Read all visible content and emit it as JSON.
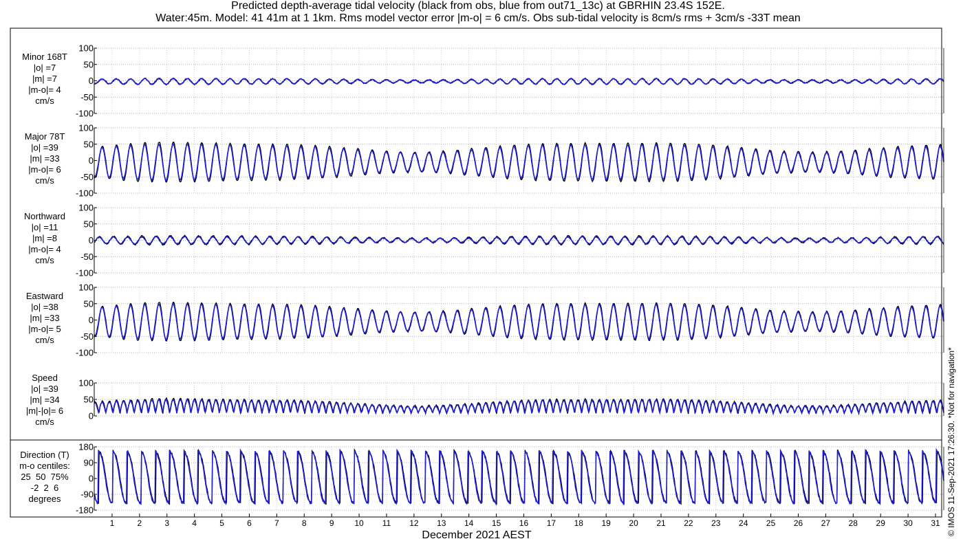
{
  "title_line1": "Predicted depth-average tidal velocity (black from obs, blue from out71_13c) at GBRHIN 23.4S 152E.",
  "title_line2": "Water:45m. Model: 41 41m at 1 1km. Rms model vector error |m-o| = 6 cm/s. Obs sub-tidal velocity is 8cm/s rms + 3cm/s -33T mean",
  "footer_note": "© IMOS 11-Sep-2021 17:26:30. *Not for navigation*",
  "colors": {
    "obs": "#000000",
    "model": "#1f1fd6",
    "grid": "#999999"
  },
  "chart_data": {
    "type": "line",
    "xlabel": "December 2021 AEST",
    "x_ticks": [
      "1",
      "2",
      "3",
      "4",
      "5",
      "6",
      "7",
      "8",
      "9",
      "10",
      "11",
      "12",
      "13",
      "14",
      "15",
      "16",
      "17",
      "18",
      "19",
      "20",
      "21",
      "22",
      "23",
      "24",
      "25",
      "26",
      "27",
      "28",
      "29",
      "30",
      "31"
    ],
    "xlim": [
      0.35,
      31.3
    ],
    "series": [
      {
        "name": "obs"
      },
      {
        "name": "out71_13c"
      }
    ],
    "panels": [
      {
        "id": "minor",
        "label_lines": [
          "Minor 168T",
          "|o| =7",
          "|m| =7",
          "|m-o|= 4",
          "cm/s"
        ],
        "ylim": [
          -100,
          100
        ],
        "yticks": [
          "100",
          "50",
          "0",
          "-50",
          "-100"
        ],
        "amp_obs": 9,
        "amp_model": 9,
        "mean_obs": -2,
        "mean_model": -2
      },
      {
        "id": "major",
        "label_lines": [
          "Major 78T",
          "|o| =39",
          "|m| =33",
          "|m-o|= 6",
          "cm/s"
        ],
        "ylim": [
          -100,
          100
        ],
        "yticks": [
          "100",
          "50",
          "0",
          "-50",
          "-100"
        ],
        "amp_obs": 62,
        "amp_model": 56,
        "mean_obs": -5,
        "mean_model": -5
      },
      {
        "id": "northward",
        "label_lines": [
          "Northward",
          "|o| =11",
          "|m| =8",
          "|m-o|= 4",
          "cm/s"
        ],
        "ylim": [
          -100,
          100
        ],
        "yticks": [
          "100",
          "50",
          "0",
          "-50",
          "-100"
        ],
        "amp_obs": 14,
        "amp_model": 11,
        "mean_obs": 0,
        "mean_model": 0
      },
      {
        "id": "eastward",
        "label_lines": [
          "Eastward",
          "|o| =38",
          "|m| =33",
          "|m-o|= 5",
          "cm/s"
        ],
        "ylim": [
          -100,
          100
        ],
        "yticks": [
          "100",
          "50",
          "0",
          "-50",
          "-100"
        ],
        "amp_obs": 60,
        "amp_model": 55,
        "mean_obs": -5,
        "mean_model": -5
      },
      {
        "id": "speed",
        "label_lines": [
          "Speed",
          "|o| =39",
          "|m| =34",
          "|m|-|o|= 6",
          "cm/s"
        ],
        "ylim": [
          0,
          100
        ],
        "yticks": [
          "100",
          "50",
          "0"
        ],
        "amp_obs": 60,
        "amp_model": 55,
        "mean_obs": 0,
        "mean_model": 0
      },
      {
        "id": "direction",
        "label_lines": [
          "Direction (T)",
          "m-o centiles:",
          "25  50  75%",
          "-2  2  6",
          "degrees"
        ],
        "ylim": [
          -180,
          180
        ],
        "yticks": [
          "180",
          "90",
          "0",
          "-90",
          "-180"
        ]
      }
    ]
  }
}
